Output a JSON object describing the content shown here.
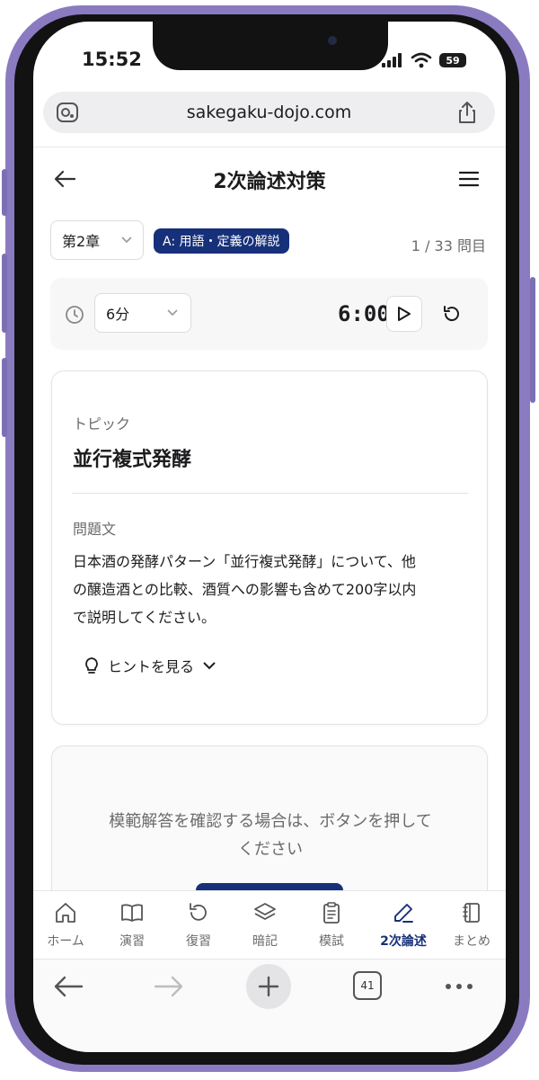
{
  "status_bar": {
    "time": "15:52",
    "battery": "59"
  },
  "browser": {
    "url": "sakegaku-dojo.com",
    "tab_count": "41"
  },
  "header": {
    "title": "2次論述対策"
  },
  "filters": {
    "chapter": "第2章",
    "category": "A: 用語・定義の解説",
    "counter": "1 / 33 問目"
  },
  "timer": {
    "duration": "6分",
    "display": "6:00"
  },
  "question": {
    "topic_label": "トピック",
    "topic": "並行複式発酵",
    "prompt_label": "問題文",
    "prompt_lines": [
      "日本酒の発酵パターン「並行複式発酵」について、他",
      "の醸造酒との比較、酒質への影響も含めて200字以内",
      "で説明してください。"
    ],
    "hint_label": "ヒントを見る"
  },
  "answer": {
    "message_lines": [
      "模範解答を確認する場合は、ボタンを押して",
      "ください"
    ]
  },
  "tabs": [
    {
      "label": "ホーム",
      "icon": "home-icon"
    },
    {
      "label": "演習",
      "icon": "book-icon"
    },
    {
      "label": "復習",
      "icon": "refresh-icon"
    },
    {
      "label": "暗記",
      "icon": "layers-icon"
    },
    {
      "label": "模試",
      "icon": "clipboard-icon"
    },
    {
      "label": "2次論述",
      "icon": "pen-icon",
      "active": true
    },
    {
      "label": "まとめ",
      "icon": "notebook-icon"
    }
  ],
  "colors": {
    "accent": "#17307a",
    "frame": "#8a7bc1"
  }
}
